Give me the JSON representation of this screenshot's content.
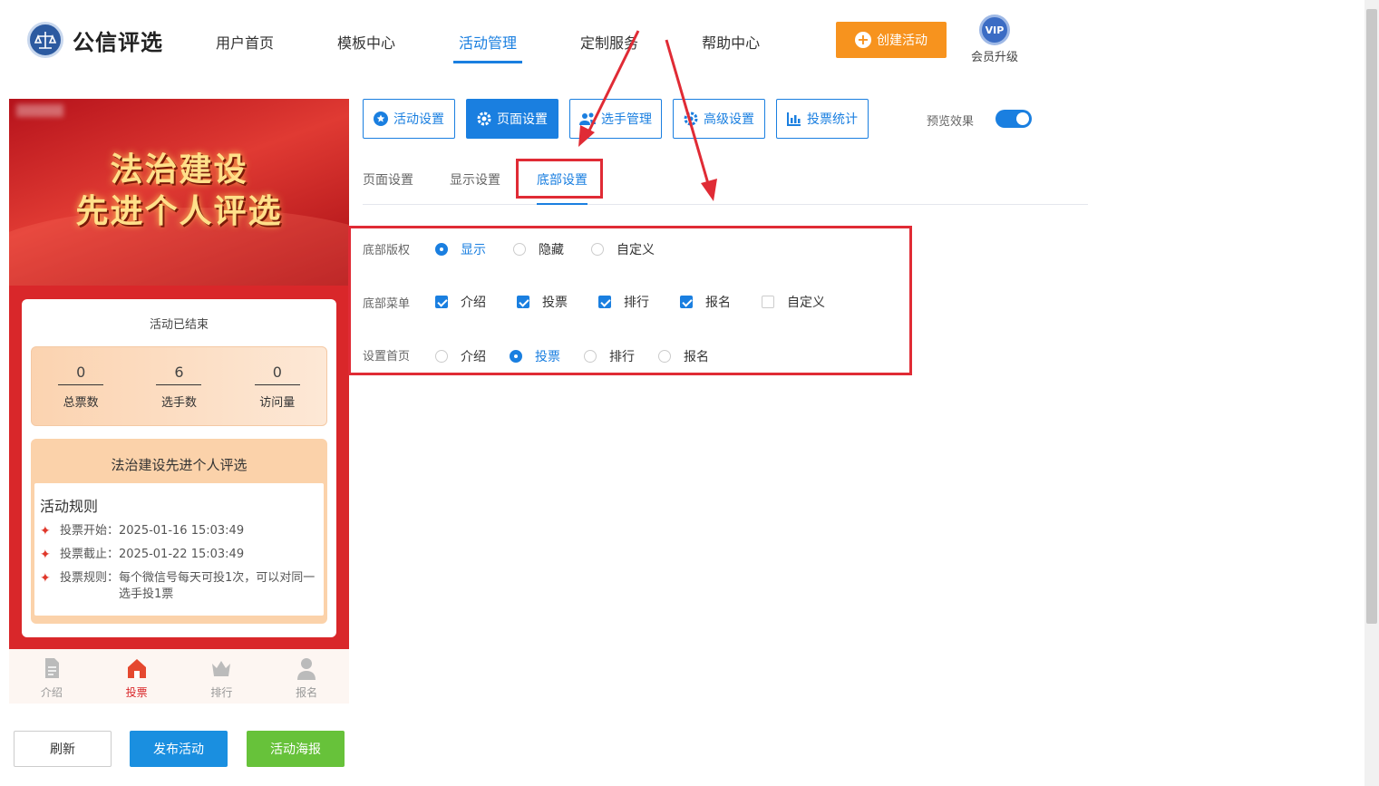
{
  "brand": {
    "name": "公信评选"
  },
  "nav": [
    {
      "label": "用户首页"
    },
    {
      "label": "模板中心"
    },
    {
      "label": "活动管理",
      "active": true
    },
    {
      "label": "定制服务"
    },
    {
      "label": "帮助中心"
    }
  ],
  "header": {
    "create_label": "创建活动",
    "vip_badge": "VIP",
    "vip_label": "会员升级"
  },
  "preview": {
    "banner_line1": "法治建设",
    "banner_line2": "先进个人评选",
    "status": "活动已结束",
    "stats": [
      {
        "value": "0",
        "label": "总票数"
      },
      {
        "value": "6",
        "label": "选手数"
      },
      {
        "value": "0",
        "label": "访问量"
      }
    ],
    "activity_title": "法治建设先进个人评选",
    "rules_title": "活动规则",
    "rules": [
      {
        "key": "投票开始：",
        "value": "2025-01-16 15:03:49"
      },
      {
        "key": "投票截止：",
        "value": "2025-01-22 15:03:49"
      },
      {
        "key": "投票规则：",
        "value": "每个微信号每天可投1次，可以对同一选手投1票"
      }
    ],
    "tabbar": [
      {
        "label": "介绍",
        "icon": "document-icon"
      },
      {
        "label": "投票",
        "icon": "home-icon",
        "active": true
      },
      {
        "label": "排行",
        "icon": "crown-icon"
      },
      {
        "label": "报名",
        "icon": "user-icon"
      }
    ]
  },
  "bottom_buttons": {
    "refresh": "刷新",
    "publish": "发布活动",
    "poster": "活动海报"
  },
  "settings_tabs": [
    {
      "label": "活动设置",
      "icon": "star-icon"
    },
    {
      "label": "页面设置",
      "icon": "gear-icon",
      "active": true
    },
    {
      "label": "选手管理",
      "icon": "users-icon"
    },
    {
      "label": "高级设置",
      "icon": "gear-icon"
    },
    {
      "label": "投票统计",
      "icon": "bar-chart-icon"
    }
  ],
  "preview_toggle": {
    "label": "预览效果",
    "on": true
  },
  "subtabs": [
    {
      "label": "页面设置"
    },
    {
      "label": "显示设置"
    },
    {
      "label": "底部设置",
      "active": true
    }
  ],
  "footer_settings": {
    "copyright": {
      "label": "底部版权",
      "options": [
        "显示",
        "隐藏",
        "自定义"
      ],
      "selected": "显示"
    },
    "menu": {
      "label": "底部菜单",
      "options": [
        "介绍",
        "投票",
        "排行",
        "报名",
        "自定义"
      ],
      "checked": [
        "介绍",
        "投票",
        "排行",
        "报名"
      ]
    },
    "home": {
      "label": "设置首页",
      "options": [
        "介绍",
        "投票",
        "排行",
        "报名"
      ],
      "selected": "投票"
    }
  },
  "colors": {
    "primary": "#1a7fe0",
    "orange": "#f7931e",
    "red": "#d9272a",
    "annotation": "#e02b35",
    "green": "#67c23a"
  }
}
